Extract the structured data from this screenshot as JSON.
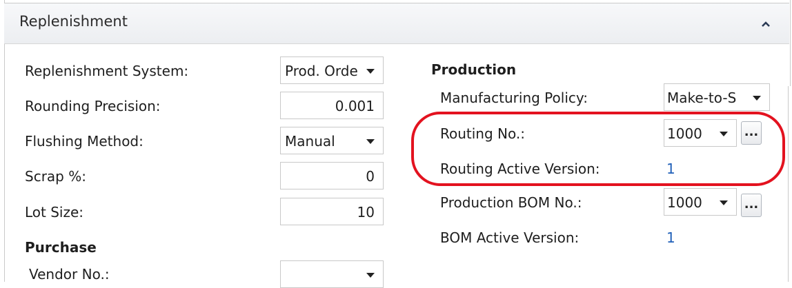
{
  "panel": {
    "title": "Replenishment",
    "collapse_icon": "chevron-up-icon"
  },
  "left": {
    "replenishment_system": {
      "label": "Replenishment System:",
      "value": "Prod. Orde"
    },
    "rounding_precision": {
      "label": "Rounding Precision:",
      "value": "0.001"
    },
    "flushing_method": {
      "label": "Flushing Method:",
      "value": "Manual"
    },
    "scrap": {
      "label": "Scrap %:",
      "value": "0"
    },
    "lot_size": {
      "label": "Lot Size:",
      "value": "10"
    },
    "purchase_title": "Purchase",
    "vendor_no": {
      "label": "Vendor No.:",
      "value": ""
    }
  },
  "right": {
    "production_title": "Production",
    "manufacturing_policy": {
      "label": "Manufacturing Policy:",
      "value": "Make-to-S"
    },
    "routing_no": {
      "label": "Routing No.:",
      "value": "1000",
      "button": "..."
    },
    "routing_active_version": {
      "label": "Routing Active Version:",
      "value": "1"
    },
    "production_bom_no": {
      "label": "Production BOM No.:",
      "value": "1000",
      "button": "..."
    },
    "bom_active_version": {
      "label": "BOM Active Version:",
      "value": "1"
    }
  },
  "colors": {
    "highlight": "#e3121f",
    "link": "#1f5fb8"
  }
}
